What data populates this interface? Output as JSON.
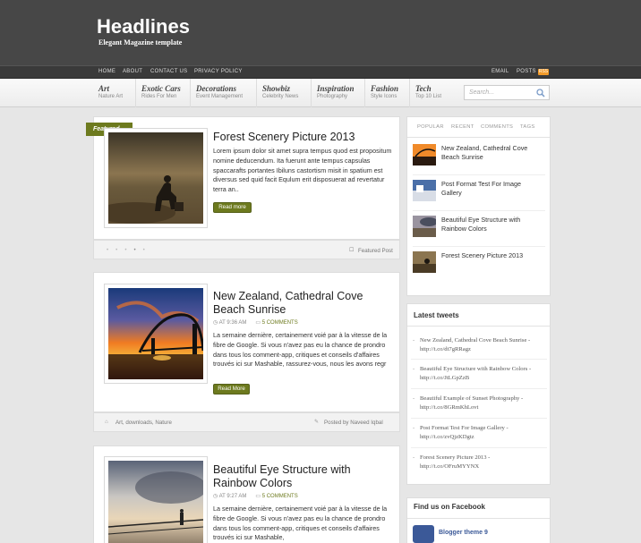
{
  "site": {
    "title": "Headlines",
    "description": "Elegant Magazine template"
  },
  "topnav": {
    "items": [
      "HOME",
      "ABOUT",
      "CONTACT US",
      "PRIVACY POLICY"
    ],
    "email": "EMAIL",
    "posts": "POSTS",
    "rss": "RSS"
  },
  "categories": [
    {
      "title": "Art",
      "sub": "Nature Art"
    },
    {
      "title": "Exotic Cars",
      "sub": "Rides For Men"
    },
    {
      "title": "Decorations",
      "sub": "Event Management"
    },
    {
      "title": "Showbiz",
      "sub": "Celebrity News"
    },
    {
      "title": "Inspiration",
      "sub": "Photography"
    },
    {
      "title": "Fashion",
      "sub": "Style Icons"
    },
    {
      "title": "Tech",
      "sub": "Top 10 List"
    }
  ],
  "search": {
    "placeholder": "Search..."
  },
  "featured_label": "Featured",
  "posts": [
    {
      "title": "Forest Scenery Picture 2013",
      "text": "Lorem ipsum dolor sit amet supra tempus quod est propositum nomine deducendum. Ita fuerunt ante tempus capsulas spaccarafts portantes Ibiluns castortism misit in spatium est diversus sed quid facit Equlum erit disposuerat ad revertatur terra an..",
      "read_more": "Read more",
      "footer_right": "Featured Post"
    },
    {
      "title": "New Zealand, Cathedral Cove Beach Sunrise",
      "time": "AT 9:36 AM",
      "comments": "5 COMMENTS",
      "text": "La semaine dernière, certainement voié par à la vitesse de la fibre de Google. Si vous n'avez pas eu la chance de prondro dans tous los comment-app, critiques et conseils d'affaires trouvés ici sur Mashable, rassurez-vous, nous les avons regr",
      "read_more": "Read More",
      "labels": "Art, downloads, Nature",
      "posted_by": "Posted by Naveed Iqbal"
    },
    {
      "title": "Beautiful Eye Structure with Rainbow Colors",
      "time": "AT 9:27 AM",
      "comments": "5 COMMENTS",
      "text": "La semaine dernière, certainement voié par à la vitesse de la fibre de Google. Si vous n'avez pas eu la chance de prondro dans tous los comment-app, critiques et conseils d'affaires trouvés ici sur Mashable,"
    }
  ],
  "sidebar": {
    "tabs": [
      "POPULAR",
      "RECENT",
      "COMMENTS",
      "TAGS"
    ],
    "popular": [
      "New Zealand, Cathedral Cove Beach Sunrise",
      "Post Format Test For Image Gallery",
      "Beautiful Eye Structure with Rainbow Colors",
      "Forest Scenery Picture 2013"
    ],
    "tweets_title": "Latest tweets",
    "tweets": [
      "New Zealand, Cathedral Cove Beach Sunrise - http://t.co/dt7gRRagz",
      "Beautiful Eye Structure with Rainbow Colors - http://t.co/JtLGpZzB",
      "Beautiful Example of Sunset Photography - http://t.co/8GRmKhLovt",
      "Post Format Test For Image Gallery - http://t.co/zvQjzKDgtz",
      "Forest Scenery Picture 2013 - http://t.co/OFruMYYNX"
    ],
    "facebook_title": "Find us on Facebook",
    "facebook_page": "Blogger theme 9"
  }
}
